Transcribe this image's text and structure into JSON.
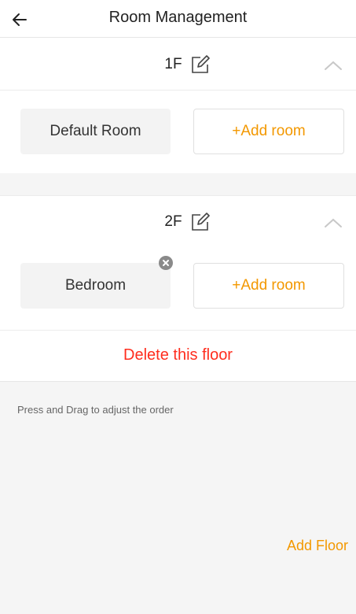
{
  "header": {
    "back_icon": "arrow-left-icon",
    "title": "Room Management"
  },
  "floors": [
    {
      "name": "1F",
      "edit_icon": "edit-icon",
      "collapse_icon": "chevron-up-icon",
      "rooms": [
        {
          "name": "Default Room",
          "removable": false
        }
      ],
      "add_room_label": "+Add room"
    },
    {
      "name": "2F",
      "edit_icon": "edit-icon",
      "collapse_icon": "chevron-up-icon",
      "rooms": [
        {
          "name": "Bedroom",
          "removable": true
        }
      ],
      "add_room_label": "+Add room",
      "delete_label": "Delete this floor"
    }
  ],
  "footer": {
    "hint": "Press and Drag to adjust the order",
    "add_floor_label": "Add Floor"
  },
  "colors": {
    "accent": "#f39800",
    "danger": "#ff2d1e",
    "chip_bg": "#f3f3f3",
    "panel_bg": "#f5f5f5"
  }
}
